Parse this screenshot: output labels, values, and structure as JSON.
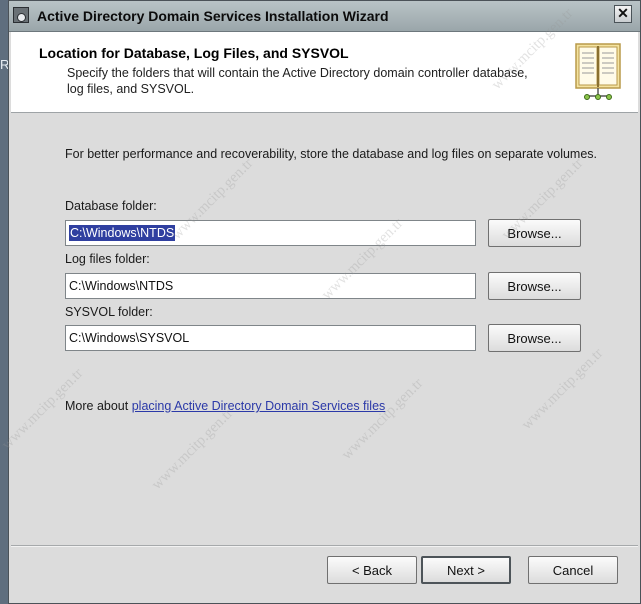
{
  "window": {
    "title": "Active Directory Domain Services Installation Wizard",
    "close_glyph": "✕"
  },
  "desktop": {
    "glyph": "R"
  },
  "header": {
    "title": "Location for Database, Log Files, and SYSVOL",
    "description": "Specify the folders that will contain the Active Directory domain controller database, log files, and SYSVOL.",
    "icon": "book-icon"
  },
  "content": {
    "intro": "For better performance and recoverability, store the database and log files on separate volumes.",
    "database": {
      "label": "Database folder:",
      "value": "C:\\Windows\\NTDS",
      "browse_label": "Browse..."
    },
    "logs": {
      "label": "Log files folder:",
      "value": "C:\\Windows\\NTDS",
      "browse_label": "Browse..."
    },
    "sysvol": {
      "label": "SYSVOL folder:",
      "value": "C:\\Windows\\SYSVOL",
      "browse_label": "Browse..."
    },
    "more_prefix": "More about ",
    "more_link": "placing Active Directory Domain Services files"
  },
  "footer": {
    "back_label": "< Back",
    "next_label": "Next >",
    "cancel_label": "Cancel"
  },
  "watermark": {
    "text": "www.mcitp.gen.tr"
  },
  "colors": {
    "link": "#2b39a8",
    "selection": "#2f3fa0",
    "panel": "#dcdcdc",
    "titlebar": "#a9b4b8"
  }
}
